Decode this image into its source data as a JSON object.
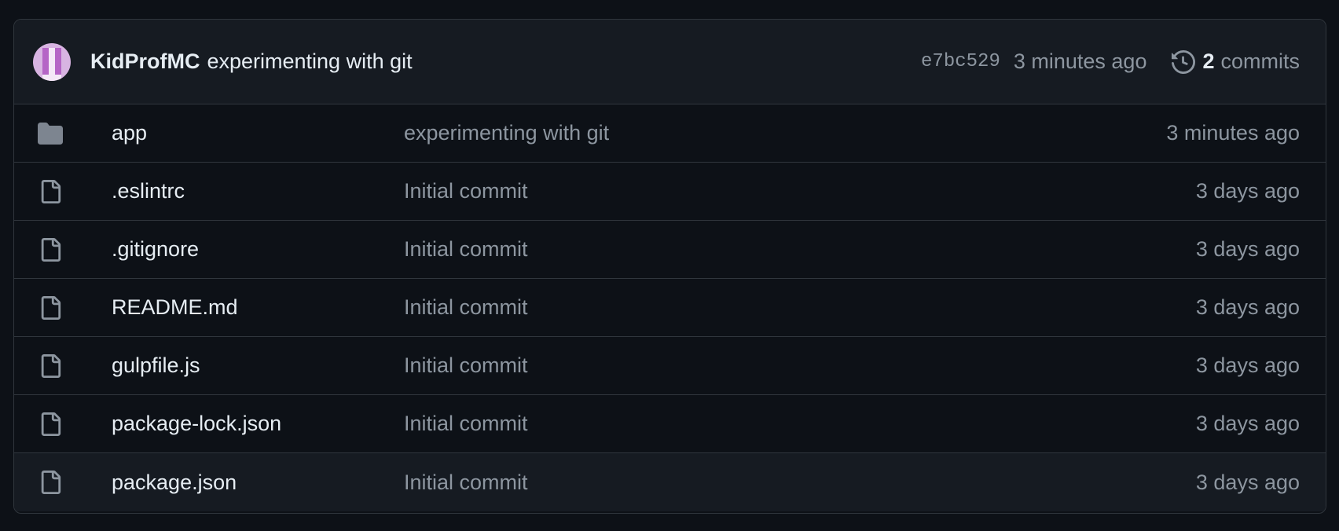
{
  "latest_commit": {
    "author": "KidProfMC",
    "message": "experimenting with git",
    "sha": "e7bc529",
    "time": "3 minutes ago",
    "commits_count": "2",
    "commits_label": "commits",
    "avatar_color": "#d8b4e2"
  },
  "files": [
    {
      "type": "folder",
      "icon": "folder-icon",
      "name": "app",
      "commit": "experimenting with git",
      "age": "3 minutes ago"
    },
    {
      "type": "file",
      "icon": "file-icon",
      "name": ".eslintrc",
      "commit": "Initial commit",
      "age": "3 days ago"
    },
    {
      "type": "file",
      "icon": "file-icon",
      "name": ".gitignore",
      "commit": "Initial commit",
      "age": "3 days ago"
    },
    {
      "type": "file",
      "icon": "file-icon",
      "name": "README.md",
      "commit": "Initial commit",
      "age": "3 days ago"
    },
    {
      "type": "file",
      "icon": "file-icon",
      "name": "gulpfile.js",
      "commit": "Initial commit",
      "age": "3 days ago"
    },
    {
      "type": "file",
      "icon": "file-icon",
      "name": "package-lock.json",
      "commit": "Initial commit",
      "age": "3 days ago"
    },
    {
      "type": "file",
      "icon": "file-icon",
      "name": "package.json",
      "commit": "Initial commit",
      "age": "3 days ago"
    }
  ],
  "colors": {
    "background": "#0d1117",
    "header_bg": "#161b22",
    "border": "#30363d",
    "text": "#e6edf3",
    "muted": "#8d96a0",
    "folder_icon": "#7d8590"
  }
}
